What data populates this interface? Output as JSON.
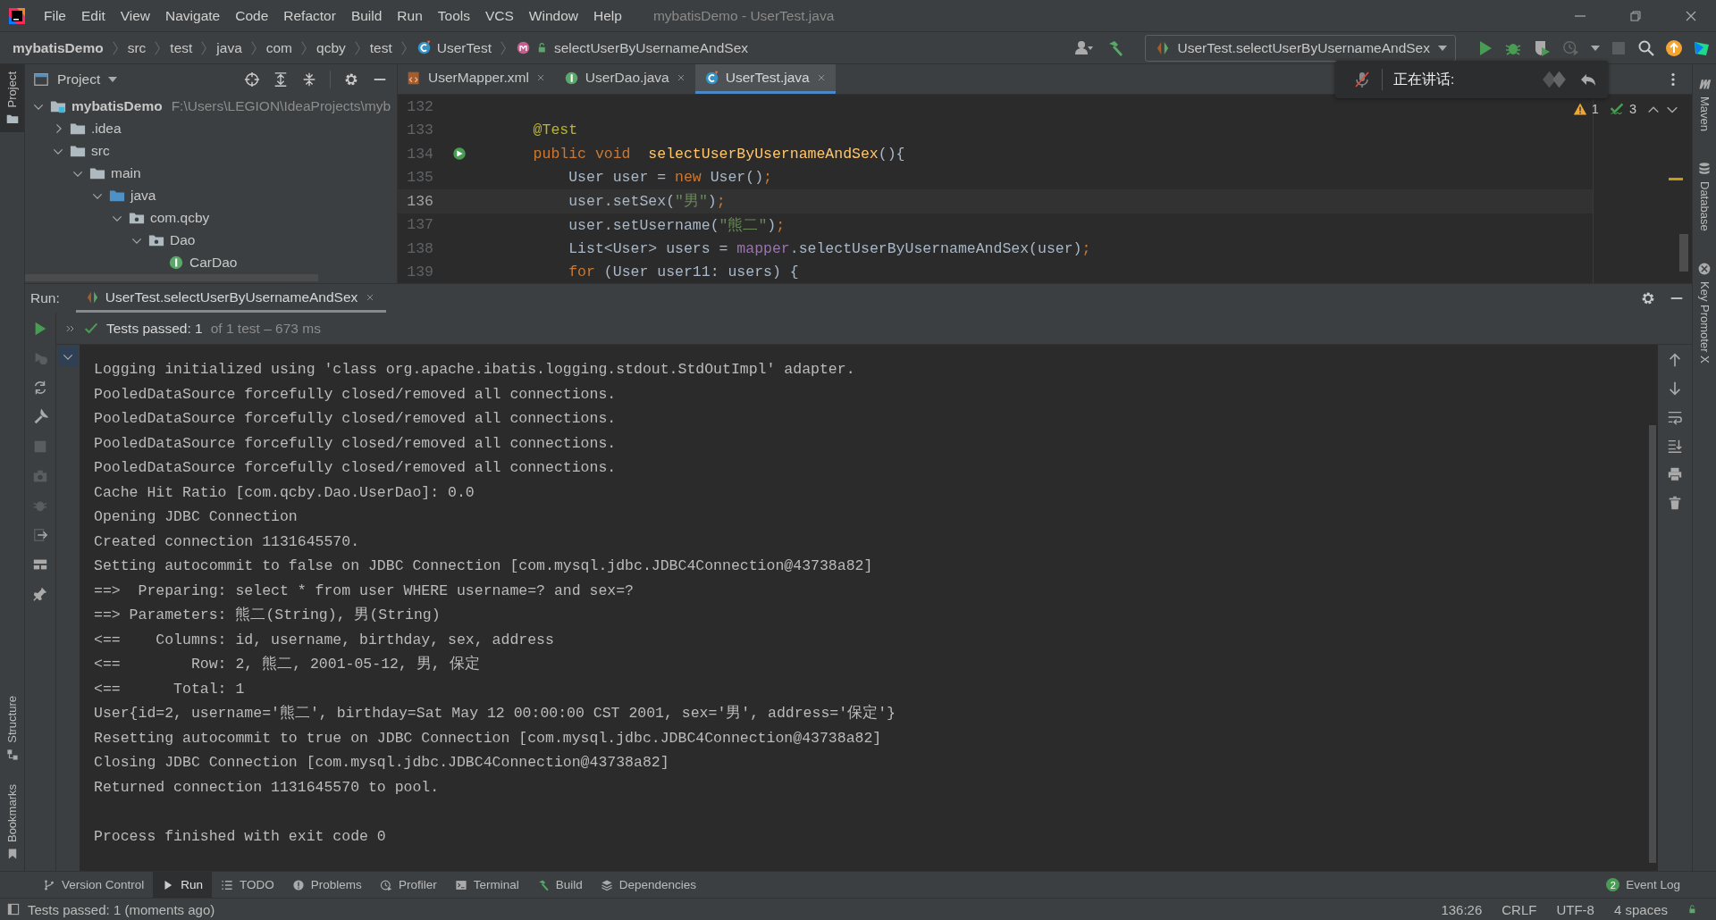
{
  "window": {
    "title": "mybatisDemo - UserTest.java"
  },
  "menu": [
    "File",
    "Edit",
    "View",
    "Navigate",
    "Code",
    "Refactor",
    "Build",
    "Run",
    "Tools",
    "VCS",
    "Window",
    "Help"
  ],
  "breadcrumbs": [
    {
      "label": "mybatisDemo",
      "kind": "project"
    },
    {
      "label": "src",
      "kind": "folder"
    },
    {
      "label": "test",
      "kind": "folder"
    },
    {
      "label": "java",
      "kind": "folder"
    },
    {
      "label": "com",
      "kind": "folder"
    },
    {
      "label": "qcby",
      "kind": "folder"
    },
    {
      "label": "test",
      "kind": "folder"
    },
    {
      "label": "UserTest",
      "kind": "class"
    },
    {
      "label": "selectUserByUsernameAndSex",
      "kind": "method"
    }
  ],
  "toolbar": {
    "run_config": "UserTest.selectUserByUsernameAndSex"
  },
  "project_panel": {
    "title": "Project",
    "tree": [
      {
        "label": "mybatisDemo",
        "path": "F:\\Users\\LEGION\\IdeaProjects\\myb",
        "kind": "module",
        "expanded": true,
        "children": [
          {
            "label": ".idea",
            "kind": "folder",
            "expanded": false
          },
          {
            "label": "src",
            "kind": "folder",
            "expanded": true,
            "children": [
              {
                "label": "main",
                "kind": "folder",
                "expanded": true,
                "children": [
                  {
                    "label": "java",
                    "kind": "source",
                    "expanded": true,
                    "children": [
                      {
                        "label": "com.qcby",
                        "kind": "package",
                        "expanded": true,
                        "children": [
                          {
                            "label": "Dao",
                            "kind": "package",
                            "expanded": true,
                            "children": [
                              {
                                "label": "CarDao",
                                "kind": "interface"
                              }
                            ]
                          }
                        ]
                      }
                    ]
                  }
                ]
              }
            ]
          }
        ]
      }
    ]
  },
  "editor": {
    "tabs": [
      {
        "label": "UserMapper.xml",
        "kind": "xml",
        "selected": false
      },
      {
        "label": "UserDao.java",
        "kind": "interface",
        "selected": false
      },
      {
        "label": "UserTest.java",
        "kind": "class",
        "selected": true
      }
    ],
    "inspections": {
      "warnings": "1",
      "passed": "3"
    },
    "lines": [
      {
        "number": "132",
        "current": false
      },
      {
        "number": "133",
        "current": false,
        "tokens": [
          {
            "text": "    @Test",
            "kind": "annotation"
          }
        ]
      },
      {
        "number": "134",
        "current": false,
        "kind": "test",
        "tokens": [
          {
            "text": "    public void",
            "kind": "keyword"
          },
          {
            "text": "  selectUserByUsernameAndSex",
            "kind": "method"
          },
          {
            "text": "(){",
            "kind": "plain"
          }
        ]
      },
      {
        "number": "135",
        "current": false,
        "tokens": [
          {
            "text": "        User user = ",
            "kind": "plain"
          },
          {
            "text": "new",
            "kind": "keyword"
          },
          {
            "text": " User()",
            "kind": "plain"
          },
          {
            "text": ";",
            "kind": "keyword"
          }
        ]
      },
      {
        "number": "136",
        "current": true,
        "tokens": [
          {
            "text": "        user.setSex(",
            "kind": "plain"
          },
          {
            "text": "\"男\"",
            "kind": "string"
          },
          {
            "text": ")",
            "kind": "plain"
          },
          {
            "text": ";",
            "kind": "keyword"
          }
        ]
      },
      {
        "number": "137",
        "current": false,
        "tokens": [
          {
            "text": "        user.setUsername(",
            "kind": "plain"
          },
          {
            "text": "\"熊二\"",
            "kind": "string"
          },
          {
            "text": ")",
            "kind": "plain"
          },
          {
            "text": ";",
            "kind": "keyword"
          }
        ]
      },
      {
        "number": "138",
        "current": false,
        "tokens": [
          {
            "text": "        List<User> users = ",
            "kind": "plain"
          },
          {
            "text": "mapper",
            "kind": "field"
          },
          {
            "text": ".selectUserByUsernameAndSex(user)",
            "kind": "plain"
          },
          {
            "text": ";",
            "kind": "keyword"
          }
        ]
      },
      {
        "number": "139",
        "current": false,
        "tokens": [
          {
            "text": "        for",
            "kind": "keyword"
          },
          {
            "text": " (User user11: users) {",
            "kind": "plain"
          }
        ]
      }
    ]
  },
  "voice_popup": {
    "label": "正在讲话:"
  },
  "run_panel": {
    "label": "Run:",
    "tab": "UserTest.selectUserByUsernameAndSex",
    "status": "Tests passed: 1",
    "detail": "of 1 test – 673 ms",
    "console": [
      {
        "text": "Logging initialized using 'class org.apache.ibatis.logging.stdout.StdOutImpl' adapter.",
        "kind": "log"
      },
      {
        "text": "PooledDataSource forcefully closed/removed all connections.",
        "kind": "log"
      },
      {
        "text": "PooledDataSource forcefully closed/removed all connections.",
        "kind": "log"
      },
      {
        "text": "PooledDataSource forcefully closed/removed all connections.",
        "kind": "log"
      },
      {
        "text": "PooledDataSource forcefully closed/removed all connections.",
        "kind": "log"
      },
      {
        "text": "Cache Hit Ratio [com.qcby.Dao.UserDao]: 0.0",
        "kind": "log"
      },
      {
        "text": "Opening JDBC Connection",
        "kind": "log"
      },
      {
        "text": "Created connection 1131645570.",
        "kind": "log"
      },
      {
        "text": "Setting autocommit to false on JDBC Connection [com.mysql.jdbc.JDBC4Connection@43738a82]",
        "kind": "log"
      },
      {
        "text": "==>  Preparing: select * from user WHERE username=? and sex=?",
        "kind": "log"
      },
      {
        "text": "==> Parameters: 熊二(String), 男(String)",
        "kind": "log"
      },
      {
        "text": "<==    Columns: id, username, birthday, sex, address",
        "kind": "log"
      },
      {
        "text": "<==        Row: 2, 熊二, 2001-05-12, 男, 保定",
        "kind": "log"
      },
      {
        "text": "<==      Total: 1",
        "kind": "log"
      },
      {
        "text": "User{id=2, username='熊二', birthday=Sat May 12 00:00:00 CST 2001, sex='男', address='保定'}",
        "kind": "log"
      },
      {
        "text": "Resetting autocommit to true on JDBC Connection [com.mysql.jdbc.JDBC4Connection@43738a82]",
        "kind": "log"
      },
      {
        "text": "Closing JDBC Connection [com.mysql.jdbc.JDBC4Connection@43738a82]",
        "kind": "log"
      },
      {
        "text": "Returned connection 1131645570 to pool.",
        "kind": "log"
      },
      {
        "text": "Process finished with exit code 0",
        "kind": "exit"
      }
    ]
  },
  "side_tabs": {
    "left_top": [
      {
        "label": "Project",
        "selected": true
      }
    ],
    "left_bottom": [
      {
        "label": "Structure",
        "selected": false
      },
      {
        "label": "Bookmarks",
        "selected": false
      }
    ],
    "right": [
      {
        "label": "Maven",
        "selected": false
      },
      {
        "label": "Database",
        "selected": false
      },
      {
        "label": "Key Promoter X",
        "selected": false
      }
    ]
  },
  "tool_windows": [
    {
      "label": "Version Control",
      "kind": "vcs",
      "selected": false
    },
    {
      "label": "Run",
      "kind": "run",
      "selected": true
    },
    {
      "label": "TODO",
      "kind": "todo",
      "selected": false
    },
    {
      "label": "Problems",
      "kind": "problems",
      "selected": false
    },
    {
      "label": "Profiler",
      "kind": "profiler",
      "selected": false
    },
    {
      "label": "Terminal",
      "kind": "terminal",
      "selected": false
    },
    {
      "label": "Build",
      "kind": "build",
      "selected": false
    },
    {
      "label": "Dependencies",
      "kind": "dependencies",
      "selected": false
    }
  ],
  "event_log": {
    "label": "Event Log",
    "count": "2"
  },
  "status_bar": {
    "message": "Tests passed: 1 (moments ago)",
    "items": [
      "136:26",
      "CRLF",
      "UTF-8",
      "4 spaces"
    ]
  }
}
